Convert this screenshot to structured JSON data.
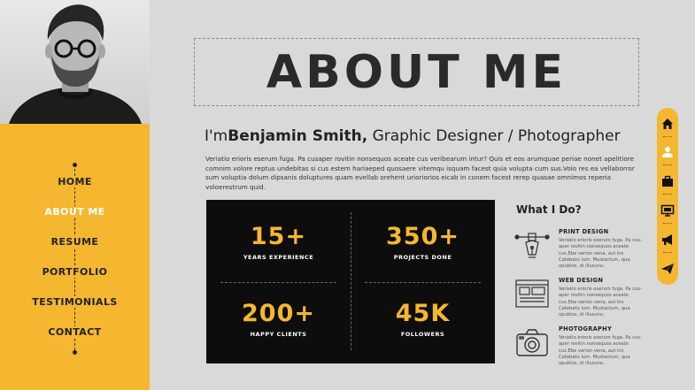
{
  "nav": {
    "items": [
      {
        "label": "HOME",
        "active": false
      },
      {
        "label": "ABOUT ME",
        "active": true
      },
      {
        "label": "RESUME",
        "active": false
      },
      {
        "label": "PORTFOLIO",
        "active": false
      },
      {
        "label": "TESTIMONIALS",
        "active": false
      },
      {
        "label": "CONTACT",
        "active": false
      }
    ]
  },
  "header": {
    "title": "ABOUT ME"
  },
  "intro": {
    "prefix": "I'm",
    "name": "Benjamin Smith,",
    "role": " Graphic Designer / Photographer"
  },
  "bio": "Veriatio erioris eserum fuga. Pa cusaper rovitin nonsequos aceate cus veribearum intur? Quis et eos arumquae periae nonet apelitiore comnim volore reptus undebitas si cus estem hariaeped quosaere vitemqu isquam facest quia volupta cum sus.Volo res ea vellaborror sum voluptia dolum dipsanis doluptures quam evellab orehent urioriorios eicab in conem facest rerep quasae omnimos reperia voloerestrum quid.",
  "stats": [
    {
      "value": "15+",
      "label": "YEARS EXPERIENCE"
    },
    {
      "value": "350+",
      "label": "PROJECTS DONE"
    },
    {
      "value": "200+",
      "label": "HAPPY CLIENTS"
    },
    {
      "value": "45K",
      "label": "FOLLOWERS"
    }
  ],
  "what_i_do": {
    "title": "What I Do?",
    "services": [
      {
        "name": "PRINT DESIGN",
        "icon": "pen-nib-icon",
        "desc": "Veriatio erioris eserum fuga. Pa cus-aper rovitin nonsequos aceate cus.Ebe verion vena, aut tro Catebatu ium. Mustactum, qua opublos, di illusunu."
      },
      {
        "name": "WEB DESIGN",
        "icon": "web-layout-icon",
        "desc": "Veriatio erioris eserum fuga. Pa cus-aper rovitin nonsequos aceate cus.Ebe verion vena, aut tro Catebatu ium. Mustactum, qua opublos, di illusunu."
      },
      {
        "name": "PHOTOGRAPHY",
        "icon": "camera-icon",
        "desc": "Veriatio erioris eserum fuga. Pa cus-aper rovitin nonsequos aceate cus.Ebe verion vena, aut tro Catebatu ium. Mustactum, qua opublos, di illusunu."
      }
    ]
  },
  "iconbar": [
    "home-icon",
    "user-icon",
    "briefcase-icon",
    "monitor-icon",
    "megaphone-icon",
    "paper-plane-icon"
  ],
  "colors": {
    "accent": "#f5b730",
    "dark": "#0d0d0d",
    "background": "#d9d9d9"
  }
}
